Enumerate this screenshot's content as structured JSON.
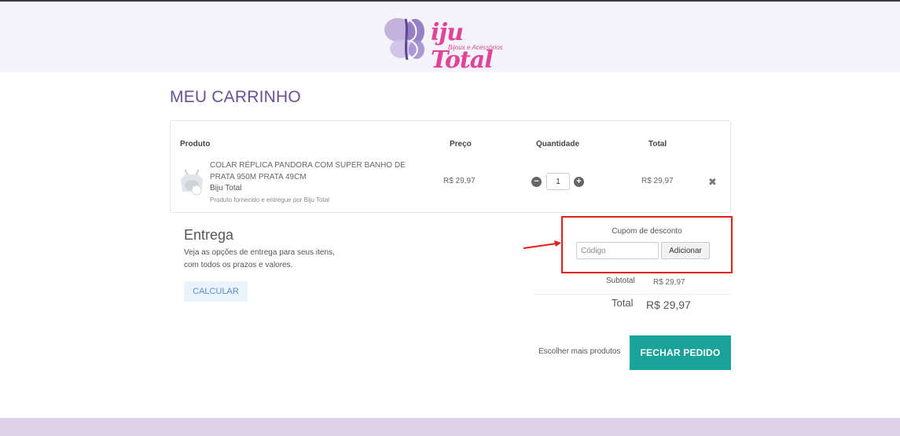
{
  "brand": {
    "logo_text": "iju Total",
    "logo_subtitle": "Bijoux e Acessórios"
  },
  "page": {
    "title": "MEU CARRINHO"
  },
  "cart": {
    "headers": {
      "produto": "Produto",
      "preco": "Preço",
      "quantidade": "Quantidade",
      "total": "Total"
    },
    "items": [
      {
        "name": "COLAR RÉPLICA PANDORA COM SUPER BANHO DE PRATA 950M PRATA 49CM",
        "brand": "Biju Total",
        "note": "Produto fornecido e entregue por Biju Total",
        "price": "R$ 29,97",
        "quantity": "1",
        "total": "R$ 29,97"
      }
    ]
  },
  "shipping": {
    "title": "Entrega",
    "description": "Veja as opções de entrega para seus itens, com todos os prazos e valores.",
    "calc_label": "CALCULAR"
  },
  "coupon": {
    "label": "Cupom de desconto",
    "placeholder": "Código",
    "button_label": "Adicionar"
  },
  "summary": {
    "subtotal_label": "Subtotal",
    "subtotal_value": "R$ 29,97",
    "total_label": "Total",
    "total_value": "R$ 29,97"
  },
  "actions": {
    "more_products": "Escolher mais produtos",
    "checkout": "FECHAR PEDIDO"
  },
  "colors": {
    "brand_purple": "#6a4f96",
    "brand_pink": "#e0449a",
    "checkout_teal": "#1aa39a",
    "highlight_red": "#e0201c"
  }
}
